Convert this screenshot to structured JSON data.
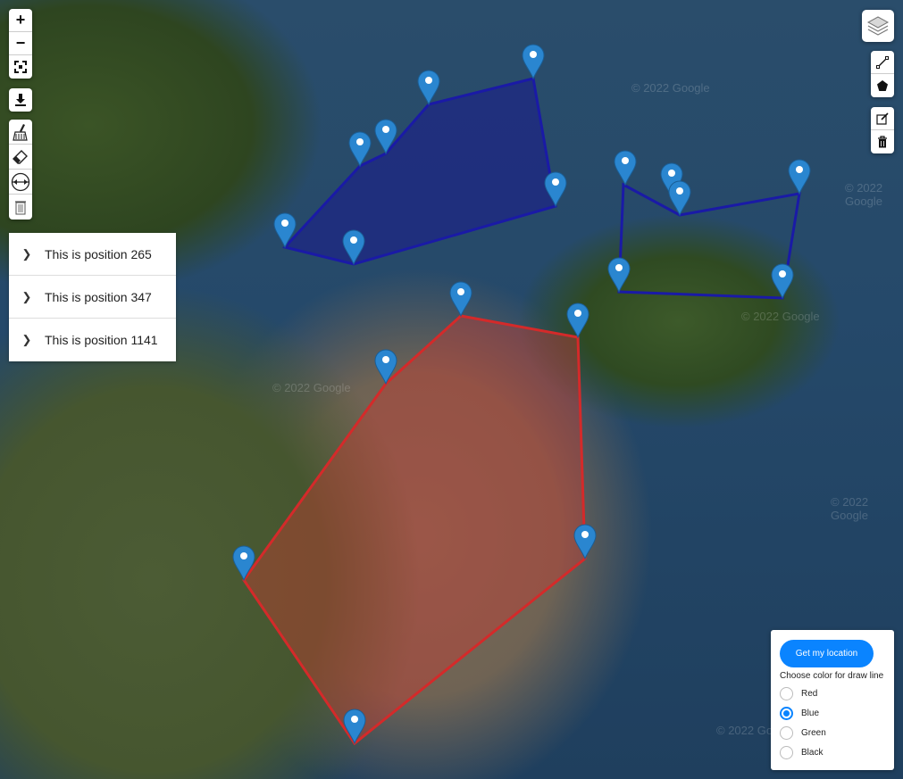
{
  "map": {
    "watermark": "© 2022 Google",
    "blue_polygon_1": {
      "color": "#1a1aa6",
      "fill": "rgba(26,26,140,0.55)"
    },
    "blue_polygon_2": {
      "color": "#1a1aa6"
    },
    "red_polygon": {
      "color": "#d42a2a",
      "fill": "rgba(200,60,50,0.45)"
    },
    "marker_color": "#2a86d0"
  },
  "controls": {
    "zoom_in_label": "+",
    "zoom_out_label": "−",
    "icons": [
      "zoom-in-icon",
      "zoom-out-icon",
      "fullscreen-icon",
      "download-icon",
      "brush-icon",
      "eraser-icon",
      "resize-icon",
      "trash-icon",
      "layers-icon",
      "polyline-icon",
      "polygon-icon",
      "edit-icon",
      "delete-icon"
    ]
  },
  "positions": {
    "items": [
      {
        "label": "This is position 265"
      },
      {
        "label": "This is position 347"
      },
      {
        "label": "This is position 1141"
      }
    ]
  },
  "panel": {
    "location_button": "Get my location",
    "color_label": "Choose color for draw line",
    "options": [
      {
        "label": "Red",
        "checked": false
      },
      {
        "label": "Blue",
        "checked": true
      },
      {
        "label": "Green",
        "checked": false
      },
      {
        "label": "Black",
        "checked": false
      }
    ],
    "accent": "#0a84ff"
  }
}
